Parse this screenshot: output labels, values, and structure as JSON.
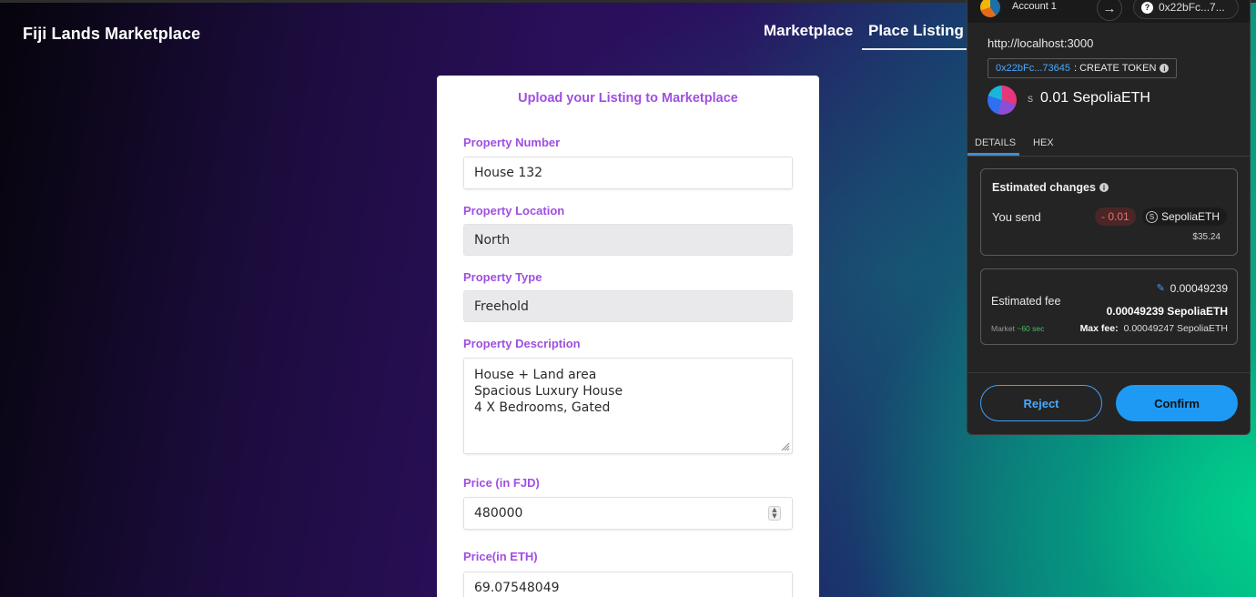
{
  "nav": {
    "brand": "Fiji Lands Marketplace",
    "links": [
      "Marketplace",
      "Place Listing"
    ]
  },
  "form": {
    "title": "Upload your Listing to Marketplace",
    "property_number": {
      "label": "Property Number",
      "value": "House 132"
    },
    "property_location": {
      "label": "Property Location",
      "value": "North"
    },
    "property_type": {
      "label": "Property Type",
      "value": "Freehold"
    },
    "property_description": {
      "label": "Property Description",
      "lines": [
        "House + Land area",
        "Spacious Luxury House",
        "4 X Bedrooms, Gated"
      ]
    },
    "price_fjd": {
      "label": "Price (in FJD)",
      "value": "480000"
    },
    "price_eth": {
      "label": "Price(in ETH)",
      "value": "69.07548049"
    }
  },
  "wallet": {
    "account_name": "Account 1",
    "address_short": "0x22bFc...7...",
    "origin": "http://localhost:3000",
    "contract_address": "0x22bFc...73645",
    "method": ": CREATE TOKEN",
    "currency_symbol": "S",
    "amount": "0.01 SepoliaETH",
    "tabs": [
      "DETAILS",
      "HEX"
    ],
    "estimated_changes": {
      "title": "Estimated changes",
      "you_send_label": "You send",
      "delta": "- 0.01",
      "token": "SepoliaETH",
      "usd": "$35.24"
    },
    "fee": {
      "label": "Estimated fee",
      "value": "0.00049239",
      "value_bold": "0.00049239 SepoliaETH",
      "market_label": "Market",
      "market_time": "~60 sec",
      "max_fee_label": "Max fee:",
      "max_fee_value": "0.00049247 SepoliaETH"
    },
    "buttons": {
      "reject": "Reject",
      "confirm": "Confirm"
    }
  }
}
